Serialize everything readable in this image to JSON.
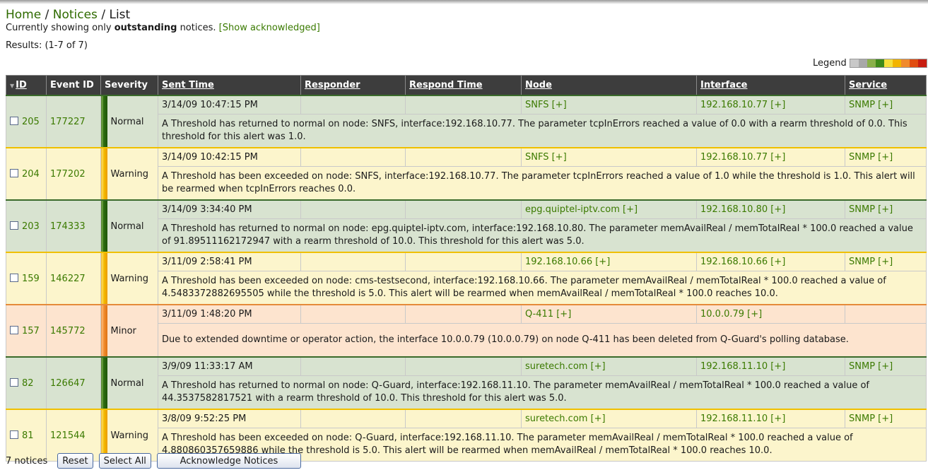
{
  "breadcrumb": {
    "home": "Home",
    "notices": "Notices",
    "current": "List",
    "sep": "/"
  },
  "status_note": {
    "prefix": "Currently showing only ",
    "emphasis": "outstanding",
    "suffix": " notices.",
    "toggle": "[Show acknowledged]"
  },
  "results": "Results: (1-7 of 7)",
  "legend": {
    "label": "Legend",
    "colors": [
      "#c8c8c8",
      "#a8a8a8",
      "#8ab04a",
      "#3f8a1a",
      "#f5df3c",
      "#f2b400",
      "#f08a2c",
      "#e04c10",
      "#c81d10"
    ]
  },
  "columns": {
    "id": "ID",
    "event_id": "Event ID",
    "severity": "Severity",
    "sent_time": "Sent Time",
    "responder": "Responder",
    "respond_time": "Respond Time",
    "node": "Node",
    "interface": "Interface",
    "service": "Service"
  },
  "notices": [
    {
      "id": "205",
      "event_id": "177227",
      "severity": "Normal",
      "sent_time": "3/14/09 10:47:15 PM",
      "responder": "",
      "respond_time": "",
      "node": "SNFS [+]",
      "interface": "192.168.10.77 [+]",
      "service": "SNMP [+]",
      "message": "A Threshold has returned to normal on node: SNFS, interface:192.168.10.77. The parameter tcpInErrors reached a value of 0.0 with a rearm threshold of 0.0. This threshold for this alert was 1.0."
    },
    {
      "id": "204",
      "event_id": "177202",
      "severity": "Warning",
      "sent_time": "3/14/09 10:42:15 PM",
      "responder": "",
      "respond_time": "",
      "node": "SNFS [+]",
      "interface": "192.168.10.77 [+]",
      "service": "SNMP [+]",
      "message": "A Threshold has been exceeded on node: SNFS, interface:192.168.10.77. The parameter tcpInErrors reached a value of 1.0 while the threshold is 1.0. This alert will be rearmed when tcpInErrors reaches 0.0."
    },
    {
      "id": "203",
      "event_id": "174333",
      "severity": "Normal",
      "sent_time": "3/14/09 3:34:40 PM",
      "responder": "",
      "respond_time": "",
      "node": "epg.quiptel-iptv.com [+]",
      "interface": "192.168.10.80 [+]",
      "service": "SNMP [+]",
      "message": "A Threshold has returned to normal on node: epg.quiptel-iptv.com, interface:192.168.10.80. The parameter memAvailReal / memTotalReal * 100.0 reached a value of 91.89511162172947 with a rearm threshold of 10.0. This threshold for this alert was 5.0."
    },
    {
      "id": "159",
      "event_id": "146227",
      "severity": "Warning",
      "sent_time": "3/11/09 2:58:41 PM",
      "responder": "",
      "respond_time": "",
      "node": "192.168.10.66 [+]",
      "interface": "192.168.10.66 [+]",
      "service": "SNMP [+]",
      "message": "A Threshold has been exceeded on node: cms-testsecond, interface:192.168.10.66. The parameter memAvailReal / memTotalReal * 100.0 reached a value of 4.5483372882695505 while the threshold is 5.0. This alert will be rearmed when memAvailReal / memTotalReal * 100.0 reaches 10.0."
    },
    {
      "id": "157",
      "event_id": "145772",
      "severity": "Minor",
      "sent_time": "3/11/09 1:48:20 PM",
      "responder": "",
      "respond_time": "",
      "node": "Q-411 [+]",
      "interface": "10.0.0.79 [+]",
      "service": "",
      "message": "Due to extended downtime or operator action, the interface 10.0.0.79 (10.0.0.79) on node Q-411 has been deleted from Q-Guard's polling database."
    },
    {
      "id": "82",
      "event_id": "126647",
      "severity": "Normal",
      "sent_time": "3/9/09 11:33:17 AM",
      "responder": "",
      "respond_time": "",
      "node": "suretech.com [+]",
      "interface": "192.168.11.10 [+]",
      "service": "SNMP [+]",
      "message": "A Threshold has returned to normal on node: Q-Guard, interface:192.168.11.10. The parameter memAvailReal / memTotalReal * 100.0 reached a value of 44.3537582817521 with a rearm threshold of 10.0. This threshold for this alert was 5.0."
    },
    {
      "id": "81",
      "event_id": "121544",
      "severity": "Warning",
      "sent_time": "3/8/09 9:52:25 PM",
      "responder": "",
      "respond_time": "",
      "node": "suretech.com [+]",
      "interface": "192.168.11.10 [+]",
      "service": "SNMP [+]",
      "message": "A Threshold has been exceeded on node: Q-Guard, interface:192.168.11.10. The parameter memAvailReal / memTotalReal * 100.0 reached a value of 4.880860357659886 while the threshold is 5.0. This alert will be rearmed when memAvailReal / memTotalReal * 100.0 reaches 10.0."
    }
  ],
  "footer": {
    "count": "7 notices",
    "reset": "Reset",
    "select_all": "Select All",
    "acknowledge": "Acknowledge Notices"
  }
}
